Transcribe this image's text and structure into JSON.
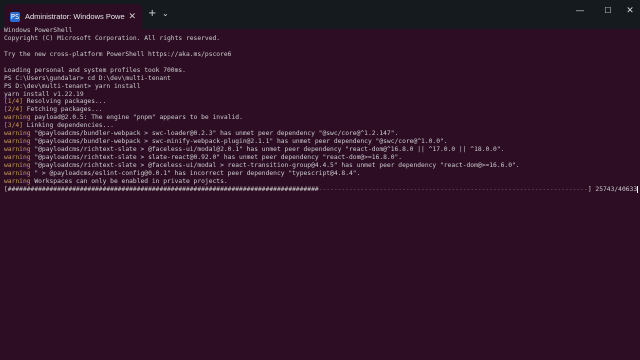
{
  "window": {
    "tab_title": "Administrator: Windows Powe",
    "tab_icon": "PS"
  },
  "titlebar": {
    "new_tab": "+",
    "dropdown": "⌄",
    "minimize": "—",
    "maximize": "☐",
    "close": "✕",
    "tab_close": "✕"
  },
  "terminal": {
    "lines": [
      {
        "text": "Windows PowerShell"
      },
      {
        "text": "Copyright (C) Microsoft Corporation. All rights reserved."
      },
      {
        "text": ""
      },
      {
        "text": "Try the new cross-platform PowerShell https://aka.ms/pscore6"
      },
      {
        "text": ""
      },
      {
        "text": "Loading personal and system profiles took 700ms."
      },
      {
        "text": "PS C:\\Users\\gundalar> cd D:\\dev\\multi-tenant"
      },
      {
        "text": "PS D:\\dev\\multi-tenant> yarn install"
      },
      {
        "text": "yarn install v1.22.19"
      },
      {
        "prefix": "[1/4]",
        "text": " Resolving packages..."
      },
      {
        "prefix": "[2/4]",
        "text": " Fetching packages..."
      },
      {
        "prefix": "warning",
        "text": " payload@2.0.5: The engine \"pnpm\" appears to be invalid."
      },
      {
        "prefix": "[3/4]",
        "text": " Linking dependencies..."
      },
      {
        "prefix": "warning",
        "text": " \"@payloadcms/bundler-webpack > swc-loader@0.2.3\" has unmet peer dependency \"@swc/core@^1.2.147\"."
      },
      {
        "prefix": "warning",
        "text": " \"@payloadcms/bundler-webpack > swc-minify-webpack-plugin@2.1.1\" has unmet peer dependency \"@swc/core@^1.0.0\"."
      },
      {
        "prefix": "warning",
        "text": " \"@payloadcms/richtext-slate > @faceless-ui/modal@2.0.1\" has unmet peer dependency \"react-dom@^16.8.0 || ^17.0.0 || ^18.0.0\"."
      },
      {
        "prefix": "warning",
        "text": " \"@payloadcms/richtext-slate > slate-react@0.92.0\" has unmet peer dependency \"react-dom@>=16.8.0\"."
      },
      {
        "prefix": "warning",
        "text": " \"@payloadcms/richtext-slate > @faceless-ui/modal > react-transition-group@4.4.5\" has unmet peer dependency \"react-dom@>=16.6.0\"."
      },
      {
        "prefix": "warning",
        "text": " \" > @payloadcms/eslint-config@0.0.1\" has incorrect peer dependency \"typescript@4.8.4\"."
      },
      {
        "prefix": "warning",
        "text": " Workspaces can only be enabled in private projects."
      }
    ],
    "progress": {
      "open": "[",
      "hashes": "##################################################################################",
      "dashes": "-----------------------------------------------------------------------",
      "close": "]",
      "counter": " 25743/40633",
      "fraction": 0.634
    }
  },
  "colors": {
    "background": "#2c0d24",
    "titlebar": "#151a1f",
    "text": "#cccccc",
    "warning": "#c9a24a"
  }
}
